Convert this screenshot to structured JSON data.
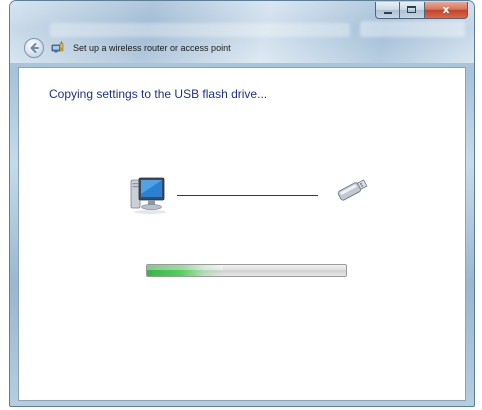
{
  "window": {
    "title": "Set up a wireless router or access point",
    "caption_buttons": {
      "minimize_icon": "minimize-icon",
      "maximize_icon": "maximize-icon",
      "close_label": "x"
    },
    "back_icon": "back-arrow-icon",
    "wizard_icon": "network-wizard-icon"
  },
  "content": {
    "heading": "Copying settings to the USB flash drive...",
    "source_icon": "computer-icon",
    "target_icon": "usb-flash-drive-icon",
    "progress_fraction": 0.38
  },
  "colors": {
    "heading_text": "#1e3287",
    "progress_green": "#39b54a",
    "close_button_red": "#c4432a"
  }
}
